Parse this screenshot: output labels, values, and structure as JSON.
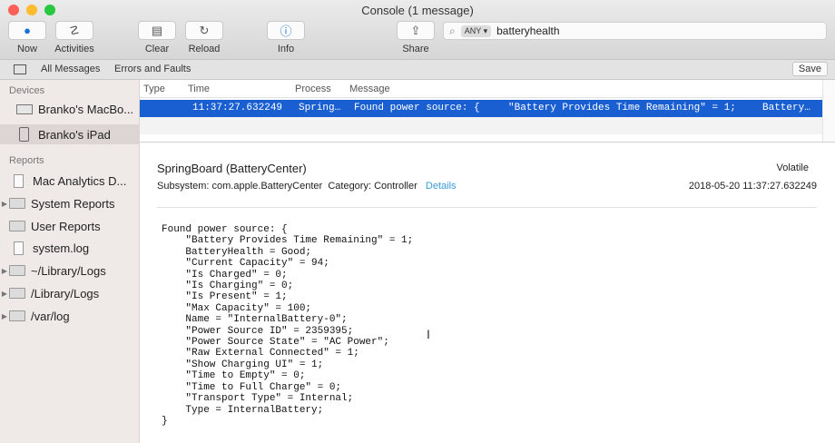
{
  "window": {
    "title": "Console (1 message)"
  },
  "toolbar": {
    "now": "Now",
    "activities": "Activities",
    "clear": "Clear",
    "reload": "Reload",
    "info": "Info",
    "share": "Share"
  },
  "search": {
    "scope": "ANY",
    "value": "batteryhealth"
  },
  "filterbar": {
    "all": "All Messages",
    "errors": "Errors and Faults",
    "save": "Save"
  },
  "sidebar": {
    "devices_header": "Devices",
    "devices": [
      "Branko's MacBo...",
      "Branko's iPad"
    ],
    "reports_header": "Reports",
    "reports": [
      "Mac Analytics D...",
      "System Reports",
      "User Reports",
      "system.log",
      "~/Library/Logs",
      "/Library/Logs",
      "/var/log"
    ]
  },
  "table": {
    "headers": [
      "Type",
      "Time",
      "Process",
      "Message"
    ],
    "row": {
      "time": "11:37:27.632249",
      "process": "Spring…",
      "message": "Found power source: {",
      "message2": "\"Battery Provides Time Remaining\" = 1;",
      "message3": "Battery…"
    }
  },
  "detail": {
    "title": "SpringBoard (BatteryCenter)",
    "volatile": "Volatile",
    "subsystem": "Subsystem: com.apple.BatteryCenter",
    "category": "Category: Controller",
    "details_link": "Details",
    "timestamp": "2018-05-20 11:37:27.632249",
    "body": "Found power source: {\n    \"Battery Provides Time Remaining\" = 1;\n    BatteryHealth = Good;\n    \"Current Capacity\" = 94;\n    \"Is Charged\" = 0;\n    \"Is Charging\" = 0;\n    \"Is Present\" = 1;\n    \"Max Capacity\" = 100;\n    Name = \"InternalBattery-0\";\n    \"Power Source ID\" = 2359395;\n    \"Power Source State\" = \"AC Power\";\n    \"Raw External Connected\" = 1;\n    \"Show Charging UI\" = 1;\n    \"Time to Empty\" = 0;\n    \"Time to Full Charge\" = 0;\n    \"Transport Type\" = Internal;\n    Type = InternalBattery;\n}"
  },
  "colors": {
    "selection": "#1a5fd1",
    "link": "#3a9bd8"
  }
}
